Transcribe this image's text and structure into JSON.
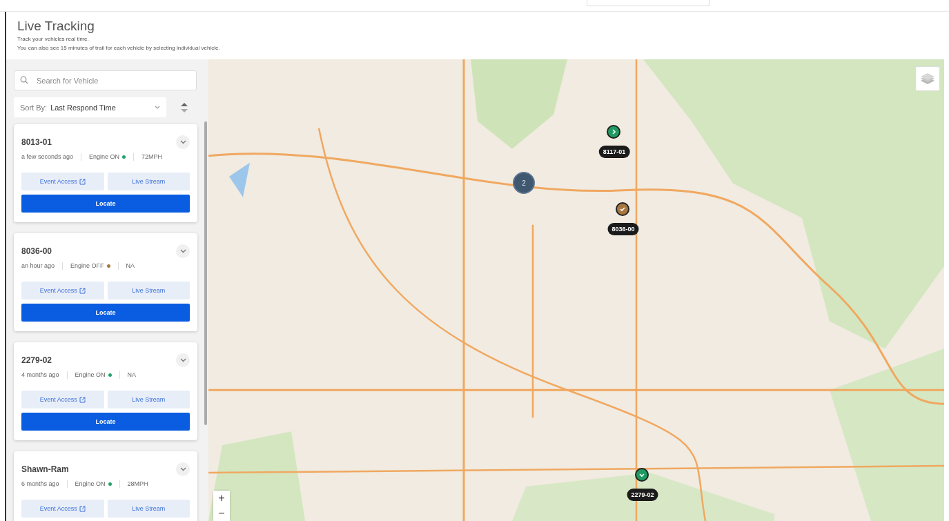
{
  "page": {
    "title": "Live Tracking",
    "subtitle_lines": [
      "Track your vehicles real time.",
      "You can also see 15 minutes of trail for each vehicle by selecting individual vehicle."
    ]
  },
  "search": {
    "placeholder": "Search for Vehicle"
  },
  "sort": {
    "label": "Sort By:",
    "value": "Last Respond Time"
  },
  "vehicles": [
    {
      "name": "8013-01",
      "last_seen": "a few seconds ago",
      "engine": "Engine ON",
      "color": "#22a36b",
      "speed": "72MPH",
      "buttons": [
        "Event Access",
        "Live Stream"
      ],
      "locate": "Locate"
    },
    {
      "name": "8036-00",
      "last_seen": "an hour ago",
      "engine": "Engine OFF",
      "color": "#a8773f",
      "speed": "NA",
      "buttons": [
        "Event Access",
        "Live Stream"
      ],
      "locate": "Locate"
    },
    {
      "name": "2279-02",
      "last_seen": "4 months ago",
      "engine": "Engine ON",
      "color": "#22a36b",
      "speed": "NA",
      "buttons": [
        "Event Access",
        "Live Stream"
      ],
      "locate": "Locate"
    },
    {
      "name": "Shawn-Ram",
      "last_seen": "6 months ago",
      "engine": "Engine ON",
      "color": "#22a36b",
      "speed": "28MPH",
      "buttons": [
        "Event Access",
        "Live Stream"
      ]
    }
  ],
  "map": {
    "kind": "picture",
    "markers": [
      {
        "label": "8117-01",
        "color": "#1f9a63",
        "kind": "moving"
      },
      {
        "label": "8036-00",
        "color": "#a8773f",
        "kind": "parked"
      },
      {
        "label": "2279-02",
        "color": "#1f9a63",
        "kind": "stopped"
      }
    ],
    "cluster": {
      "count": "2"
    },
    "zoom": {
      "in": "+",
      "out": "−"
    }
  }
}
